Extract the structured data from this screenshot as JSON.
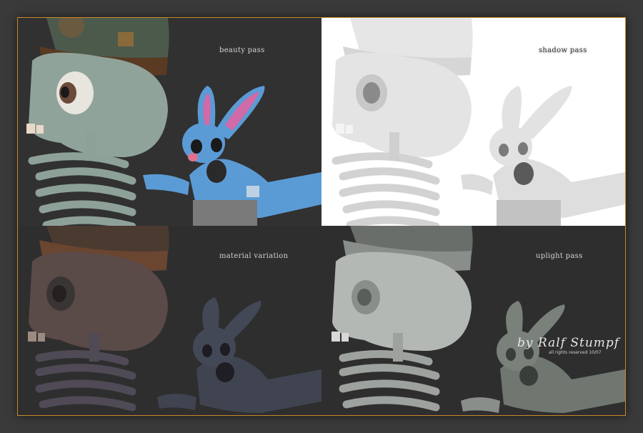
{
  "panels": {
    "beauty": {
      "label": "beauty pass"
    },
    "shadow": {
      "label": "shadow pass"
    },
    "material": {
      "label": "material variation"
    },
    "uplight": {
      "label": "uplight pass"
    }
  },
  "credit": {
    "signature": "by Ralf Stumpf",
    "copyright": "all rights reserved 10/07"
  },
  "colors": {
    "frame_border": "#c9892f",
    "background": "#3a3a3a",
    "rabbit_blue": "#5b9bd5",
    "rabbit_ear_pink": "#d06aa8"
  }
}
